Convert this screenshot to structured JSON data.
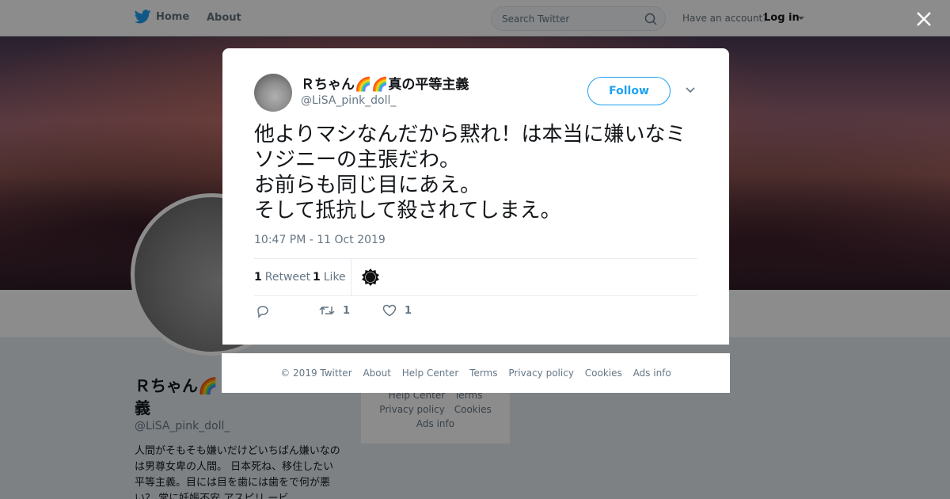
{
  "topbar": {
    "home_label": "Home",
    "about_label": "About",
    "search_placeholder": "Search Twitter",
    "account_prompt": "Have an account?",
    "login_label": "Log in"
  },
  "profile": {
    "name_line1": "Ｒちゃん🌈",
    "name_line2": "義",
    "handle": "@LiSA_pink_doll_",
    "bio": "人間がそもそも嫌いだけどいちばん嫌いなのは男尊女卑の人間。 日本死ね、移住したい 平等主義。目には目を歯には歯をで何が悪い？ 常に妊娠不安 アスピリ ービ"
  },
  "bg_footer": {
    "links": [
      "Help Center",
      "Terms",
      "Privacy policy",
      "Cookies",
      "Ads info"
    ]
  },
  "tweet": {
    "display_name": "Ｒちゃん🌈🌈真の平等主義",
    "handle": "@LiSA_pink_doll_",
    "follow_label": "Follow",
    "text": "他よりマシなんだから黙れ！は本当に嫌いなミソジニーの主張だわ。\nお前らも同じ目にあえ。\nそして抵抗して殺されてしまえ。",
    "timestamp": "10:47 PM - 11 Oct 2019",
    "retweet_count": "1",
    "retweet_label": "Retweet",
    "like_count": "1",
    "like_label": "Like",
    "action_retweet_count": "1",
    "action_like_count": "1"
  },
  "footer": {
    "copyright": "© 2019 Twitter",
    "about": "About",
    "help": "Help Center",
    "terms": "Terms",
    "privacy": "Privacy policy",
    "cookies": "Cookies",
    "ads": "Ads info"
  },
  "colors": {
    "accent": "#1da1f2",
    "text_secondary": "#657786"
  },
  "icons": [
    "twitter-bird-icon",
    "search-icon",
    "close-icon",
    "chevron-down-icon",
    "reply-icon",
    "retweet-icon",
    "heart-icon"
  ]
}
